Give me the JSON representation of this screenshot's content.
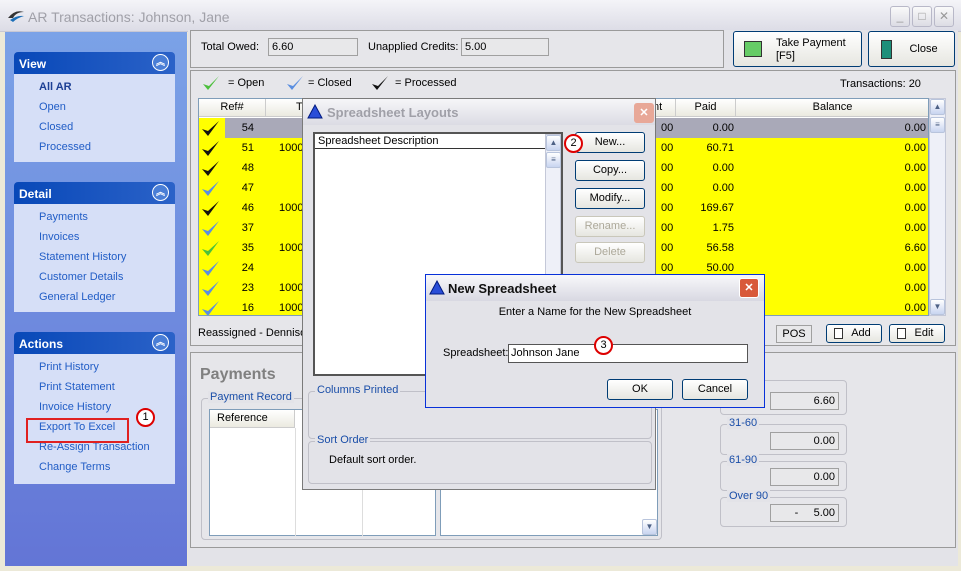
{
  "window": {
    "title": "AR Transactions: Johnson, Jane",
    "minimize": "_",
    "maximize": "□",
    "close": "✕"
  },
  "sidebar": {
    "view": {
      "title": "View",
      "items": [
        "All AR",
        "Open",
        "Closed",
        "Processed"
      ]
    },
    "detail": {
      "title": "Detail",
      "items": [
        "Payments",
        "Invoices",
        "Statement History",
        "Customer Details",
        "General Ledger"
      ]
    },
    "actions": {
      "title": "Actions",
      "items": [
        "Print History",
        "Print Statement",
        "Invoice History",
        "Export To Excel",
        "Re-Assign Transaction",
        "Change Terms"
      ]
    }
  },
  "summary": {
    "total_owed_label": "Total Owed:",
    "total_owed": "6.60",
    "unapplied_label": "Unapplied Credits:",
    "unapplied": "5.00"
  },
  "toolbar": {
    "take_payment": "Take Payment",
    "take_payment_key": "[F5]",
    "close": "Close"
  },
  "legend": {
    "open": "= Open",
    "closed": "= Closed",
    "processed": "= Processed",
    "transactions_label": "Transactions:",
    "transactions": "20"
  },
  "colors": {
    "open": "#4cbf3c",
    "closed": "#5a8ee0",
    "processed": "#111111",
    "row": "#ffff00",
    "selected": "#a9a9b8"
  },
  "grid": {
    "headers": {
      "ref": "Ref#",
      "t": "T",
      "amount": "nt",
      "paid": "Paid",
      "balance": "Balance"
    },
    "rows": [
      {
        "status": "processed",
        "ref": "54",
        "t": "",
        "amount": "00",
        "paid": "0.00",
        "balance": "0.00"
      },
      {
        "status": "processed",
        "ref": "51",
        "t": "1000",
        "amount": "00",
        "paid": "60.71",
        "balance": "0.00"
      },
      {
        "status": "processed",
        "ref": "48",
        "t": "",
        "amount": "00",
        "paid": "0.00",
        "balance": "0.00"
      },
      {
        "status": "closed",
        "ref": "47",
        "t": "",
        "amount": "00",
        "paid": "0.00",
        "balance": "0.00"
      },
      {
        "status": "processed",
        "ref": "46",
        "t": "1000",
        "amount": "00",
        "paid": "169.67",
        "balance": "0.00"
      },
      {
        "status": "closed",
        "ref": "37",
        "t": "",
        "amount": "00",
        "paid": "1.75",
        "balance": "0.00"
      },
      {
        "status": "open",
        "ref": "35",
        "t": "1000",
        "amount": "00",
        "paid": "56.58",
        "balance": "6.60"
      },
      {
        "status": "closed",
        "ref": "24",
        "t": "",
        "amount": "00",
        "paid": "50.00",
        "balance": "0.00"
      },
      {
        "status": "closed",
        "ref": "23",
        "t": "1000",
        "amount": "",
        "paid": "",
        "balance": "0.00"
      },
      {
        "status": "closed",
        "ref": "16",
        "t": "1000",
        "amount": "",
        "paid": "",
        "balance": "0.00"
      }
    ]
  },
  "status": {
    "text": "Reassigned - Denniso",
    "pos": "POS",
    "add": "Add",
    "edit": "Edit"
  },
  "payments": {
    "title": "Payments",
    "record_label": "Payment Record",
    "reference_header": "Reference"
  },
  "aging": [
    {
      "label": "",
      "value": "6.60"
    },
    {
      "label": "31-60",
      "value": "0.00"
    },
    {
      "label": "61-90",
      "value": "0.00"
    },
    {
      "label": "Over 90",
      "value": "-     5.00"
    }
  ],
  "layouts_dialog": {
    "title": "Spreadsheet Layouts",
    "list_header": "Spreadsheet Description",
    "new": "New...",
    "copy": "Copy...",
    "modify": "Modify...",
    "rename": "Rename...",
    "delete": "Delete",
    "columns_printed": "Columns Printed",
    "sort_order": "Sort Order",
    "sort_text": "Default sort order."
  },
  "new_dialog": {
    "title": "New Spreadsheet",
    "prompt": "Enter a Name for the New Spreadsheet",
    "label": "Spreadsheet:",
    "value": "Johnson Jane",
    "ok": "OK",
    "cancel": "Cancel"
  },
  "callouts": [
    "1",
    "2",
    "3"
  ]
}
